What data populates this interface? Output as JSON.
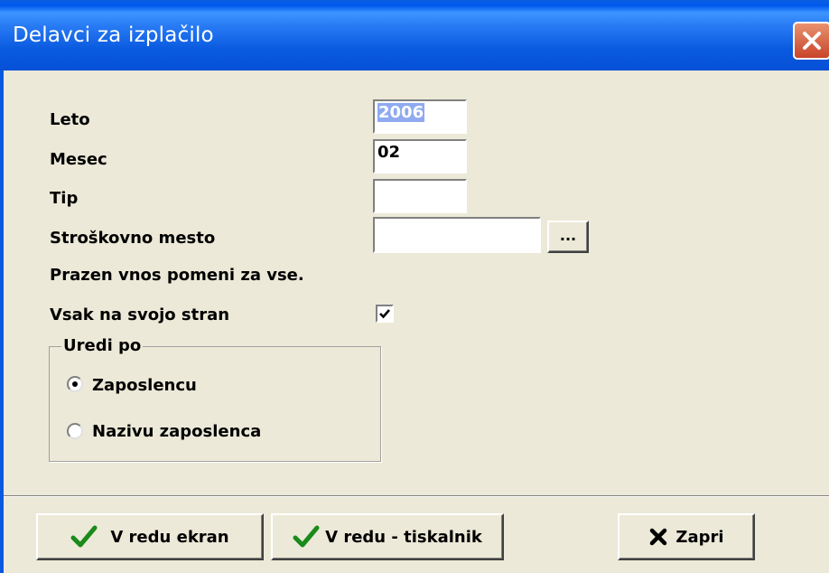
{
  "window": {
    "title": "Delavci za izplačilo"
  },
  "form": {
    "leto_label": "Leto",
    "leto_value": "2006",
    "mesec_label": "Mesec",
    "mesec_value": "02",
    "tip_label": "Tip",
    "tip_value": "",
    "stroskovno_label": "Stroškovno mesto",
    "stroskovno_value": "",
    "browse_label": "...",
    "hint": "Prazen vnos pomeni za vse.",
    "vsak_label": "Vsak na svojo stran",
    "vsak_checked": true
  },
  "sort_group": {
    "legend": "Uredi po",
    "options": [
      {
        "label": "Zaposlencu",
        "selected": true
      },
      {
        "label": "Nazivu zaposlenca",
        "selected": false
      }
    ]
  },
  "buttons": {
    "ok_screen": "V redu ekran",
    "ok_printer": "V redu - tiskalnik",
    "close": "Zapri"
  },
  "colors": {
    "title_bar": "#0a5ae0",
    "selection": "#8faaf0",
    "dialog_bg": "#ece9d8",
    "close_button": "#d0562f"
  }
}
